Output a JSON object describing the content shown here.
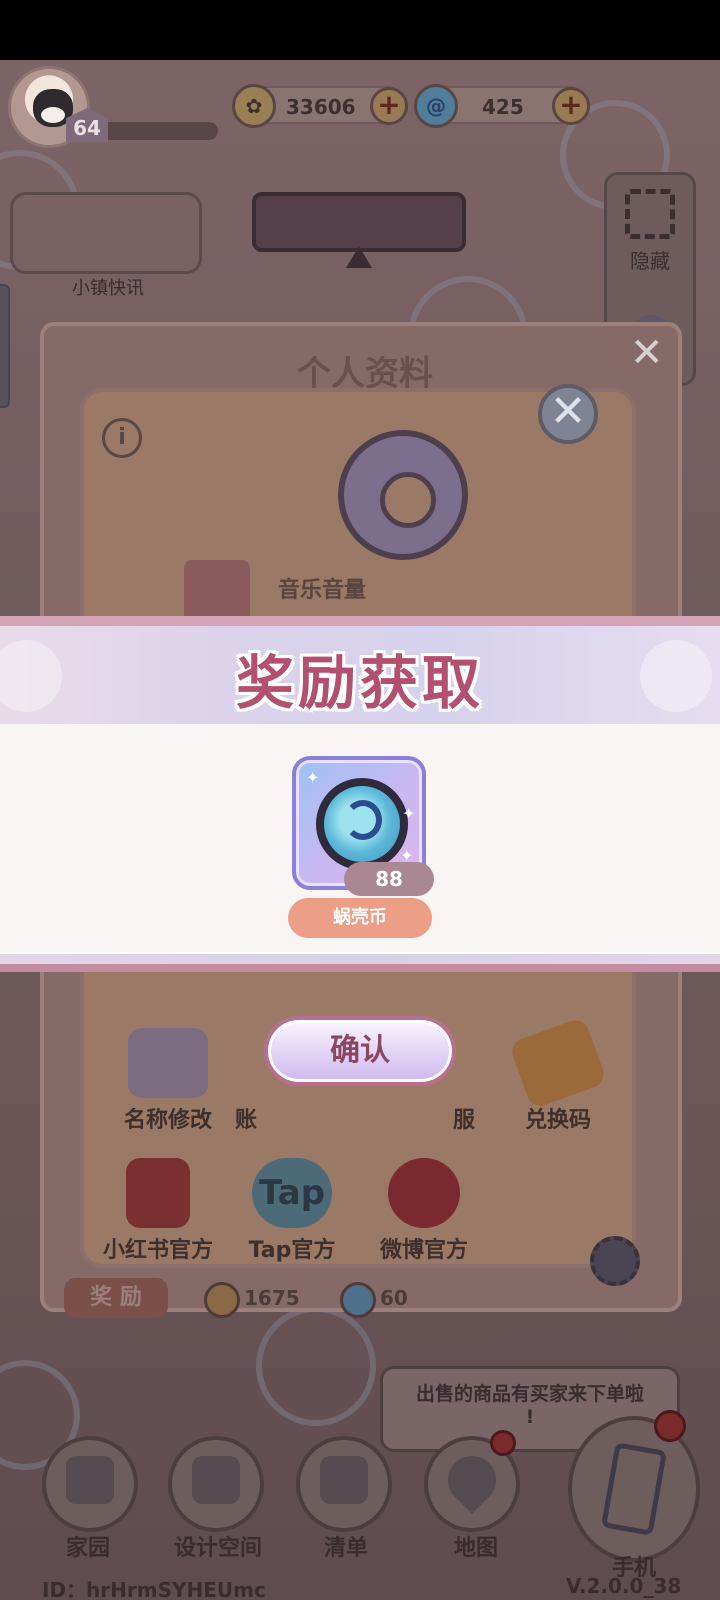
{
  "hud": {
    "level": "64",
    "gold": "33606",
    "shell_coins": "425"
  },
  "left_panel": {
    "news_label": "小镇快讯"
  },
  "right_panel": {
    "hide_label": "隐藏"
  },
  "profile": {
    "title": "个人资料",
    "music_label": "音乐音量",
    "actions": [
      {
        "label": "名称修改"
      },
      {
        "label": "账"
      },
      {
        "label": "服"
      },
      {
        "label": "兑换码"
      },
      {
        "label": "小红书官方"
      },
      {
        "label": "Tap官方"
      },
      {
        "label": "微博官方"
      }
    ],
    "reward_label": "奖 励",
    "reward_gold": "1675",
    "reward_shell": "60"
  },
  "toast": {
    "line1": "出售的商品有买家来下单啦",
    "line2": "!"
  },
  "bottom_nav": {
    "home": "家园",
    "design": "设计空间",
    "list": "清单",
    "map": "地图",
    "phone": "手机"
  },
  "footer": {
    "user_id": "ID：hrHrmSYHEUmc",
    "version": "V.2.0.0_38"
  },
  "reward_popup": {
    "title": "奖励获取",
    "item_count": "88",
    "item_name": "蜗壳币",
    "confirm": "确认"
  },
  "colors": {
    "title_pink": "#b4506f",
    "confirm_text": "#8a4663",
    "name_pill": "#ec9e86",
    "card_border": "#8b7fd8"
  }
}
